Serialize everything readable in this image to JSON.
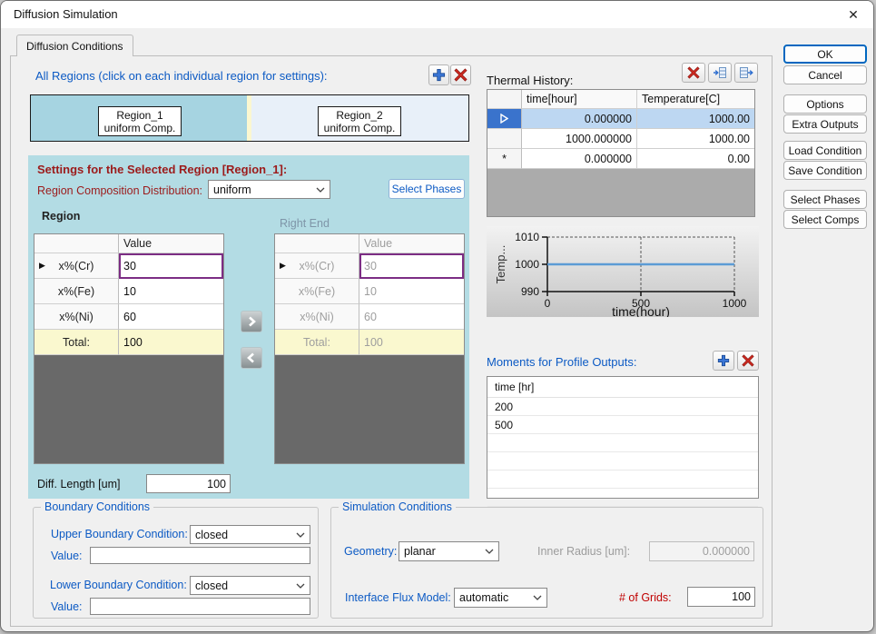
{
  "window": {
    "title": "Diffusion Simulation",
    "close_glyph": "✕"
  },
  "tab": {
    "label": "Diffusion Conditions"
  },
  "all_regions": {
    "label": "All Regions (click on each individual region for settings):",
    "regions": [
      {
        "name": "Region_1",
        "comp": "uniform Comp."
      },
      {
        "name": "Region_2",
        "comp": "uniform Comp."
      }
    ]
  },
  "settings": {
    "title": "Settings for the Selected Region [Region_1]:",
    "composition_label": "Region Composition Distribution:",
    "composition_value": "uniform",
    "select_phases_button": "Select Phases",
    "region_table": {
      "title": "Region",
      "value_header": "Value",
      "rows": [
        {
          "label": "x%(Cr)",
          "value": "30"
        },
        {
          "label": "x%(Fe)",
          "value": "10"
        },
        {
          "label": "x%(Ni)",
          "value": "60"
        }
      ],
      "total_label": "Total:",
      "total_value": "100"
    },
    "right_end_table": {
      "title": "Right End",
      "value_header": "Value",
      "rows": [
        {
          "label": "x%(Cr)",
          "value": "30"
        },
        {
          "label": "x%(Fe)",
          "value": "10"
        },
        {
          "label": "x%(Ni)",
          "value": "60"
        }
      ],
      "total_label": "Total:",
      "total_value": "100"
    },
    "diff_length_label": "Diff. Length [um]",
    "diff_length_value": "100"
  },
  "thermal": {
    "label": "Thermal History:",
    "columns": {
      "time": "time[hour]",
      "temp": "Temperature[C]"
    },
    "rows": [
      {
        "marker": "",
        "time": "0.000000",
        "temp": "1000.00",
        "selected": true
      },
      {
        "marker": "",
        "time": "1000.000000",
        "temp": "1000.00",
        "selected": false
      },
      {
        "marker": "*",
        "time": "0.000000",
        "temp": "0.00",
        "selected": false
      }
    ]
  },
  "chart": {
    "ylabel": "Temp...",
    "xlabel": "time(hour)",
    "yticks": [
      "1010",
      "1000",
      "990"
    ],
    "xticks": [
      "0",
      "500",
      "1000"
    ]
  },
  "chart_data": {
    "type": "line",
    "xlabel": "time(hour)",
    "ylabel": "Temp...",
    "xlim": [
      0,
      1000
    ],
    "ylim": [
      990,
      1010
    ],
    "xticks": [
      0,
      500,
      1000
    ],
    "yticks": [
      990,
      1000,
      1010
    ],
    "series": [
      {
        "name": "Temperature[C]",
        "x": [
          0,
          1000
        ],
        "values": [
          1000,
          1000
        ]
      }
    ],
    "line_color": "#5b9bd5",
    "grid": "dashed vertical at x=500, dashed top/right frame"
  },
  "moments": {
    "label": "Moments for Profile Outputs:",
    "header": "time [hr]",
    "values": [
      "200",
      "500"
    ]
  },
  "buttons": {
    "ok": "OK",
    "cancel": "Cancel",
    "options": "Options",
    "extra_outputs": "Extra Outputs",
    "load_condition": "Load Condition",
    "save_condition": "Save Condition",
    "select_phases": "Select Phases",
    "select_comps": "Select Comps"
  },
  "boundary": {
    "title": "Boundary Conditions",
    "upper_label": "Upper Boundary Condition:",
    "upper_value": "closed",
    "upper_value_label": "Value:",
    "upper_value_field": "",
    "lower_label": "Lower Boundary Condition:",
    "lower_value": "closed",
    "lower_value_label": "Value:",
    "lower_value_field": ""
  },
  "simulation": {
    "title": "Simulation Conditions",
    "geometry_label": "Geometry:",
    "geometry_value": "planar",
    "inner_radius_label": "Inner Radius [um]:",
    "inner_radius_value": "0.000000",
    "flux_label": "Interface Flux Model:",
    "flux_value": "automatic",
    "grids_label": "# of Grids:",
    "grids_value": "100"
  },
  "icons": {
    "add": "plus",
    "delete": "red-x",
    "insert_row": "table-insert",
    "export_rows": "table-export",
    "move_right": "❯",
    "move_left": "❮",
    "row_selector": "▶",
    "dropdown": "⌄"
  },
  "colors": {
    "label_blue": "#0c5ac4",
    "label_red": "#9c1b1b",
    "grids_red": "#c00000",
    "panel_bg": "#b3dce4",
    "region1_bg": "#a6d4e1",
    "region2_bg": "#e8f0f9",
    "total_row_bg": "#faf8cf",
    "selected_row_bg": "#bdd7f2",
    "chart_line": "#5b9bd5"
  }
}
